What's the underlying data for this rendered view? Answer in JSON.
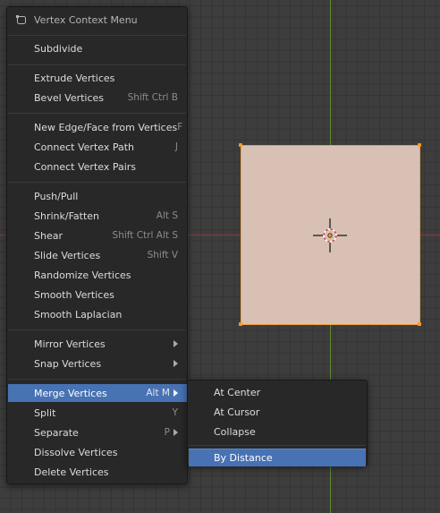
{
  "menu": {
    "title": "Vertex Context Menu",
    "items": {
      "subdivide": "Subdivide",
      "extrude": "Extrude Vertices",
      "bevel": "Bevel Vertices",
      "bevel_sc": "Shift Ctrl B",
      "new_edge_face": "New Edge/Face from Vertices",
      "new_edge_face_sc": "F",
      "connect_path": "Connect Vertex Path",
      "connect_path_sc": "J",
      "connect_pairs": "Connect Vertex Pairs",
      "push_pull": "Push/Pull",
      "shrink_fatten": "Shrink/Fatten",
      "shrink_fatten_sc": "Alt S",
      "shear": "Shear",
      "shear_sc": "Shift Ctrl Alt S",
      "slide": "Slide Vertices",
      "slide_sc": "Shift V",
      "randomize": "Randomize Vertices",
      "smooth": "Smooth Vertices",
      "smooth_laplacian": "Smooth Laplacian",
      "mirror": "Mirror Vertices",
      "snap": "Snap Vertices",
      "merge": "Merge Vertices",
      "merge_sc": "Alt M",
      "split": "Split",
      "split_sc": "Y",
      "separate": "Separate",
      "separate_sc": "P",
      "dissolve": "Dissolve Vertices",
      "delete": "Delete Vertices"
    }
  },
  "submenu": {
    "at_center": "At Center",
    "at_cursor": "At Cursor",
    "collapse": "Collapse",
    "by_distance": "By Distance"
  },
  "colors": {
    "highlight": "#4772b3",
    "menu_bg": "#282828",
    "viewport_bg": "#3d3d3d",
    "x_axis": "#8a3a3a",
    "y_axis": "#5f8a2f",
    "selection_outline": "#f0a040",
    "plane_face": "#d8c0b4"
  },
  "icons": {
    "header": "vertex-menu-icon",
    "submenu": "submenu-arrow-icon",
    "cursor": "3d-cursor-icon"
  }
}
